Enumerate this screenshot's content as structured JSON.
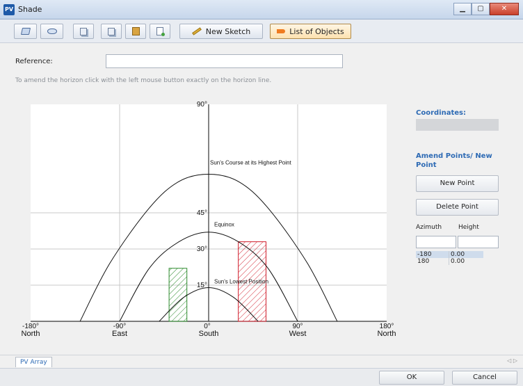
{
  "window": {
    "title": "Shade",
    "app_icon": "PV",
    "buttons": {
      "minimize": "▁",
      "maximize": "▢",
      "close": "✕"
    }
  },
  "toolbar": {
    "icons": [
      "folder-open-icon",
      "view-icon",
      "copy-icon",
      "copy-icon",
      "paste-icon",
      "new-document-icon",
      "pencil-icon",
      "list-icon"
    ],
    "new_sketch": "New Sketch",
    "list_of_objects": "List of Objects"
  },
  "reference": {
    "label": "Reference:",
    "value": ""
  },
  "hint": "To amend the horizon click with the left mouse button exactly on the horizon line.",
  "side_panel": {
    "coordinates_title": "Coordinates:",
    "coordinates_value": "",
    "amend_title": "Amend Points/ New Point",
    "new_point": "New Point",
    "delete_point": "Delete Point",
    "azimuth_label": "Azimuth",
    "height_label": "Height",
    "azimuth_input": "",
    "height_input": "",
    "points": [
      {
        "azimuth": "-180",
        "height": "0.00"
      },
      {
        "azimuth": "180",
        "height": "0.00"
      }
    ]
  },
  "tabs": [
    "PV Array"
  ],
  "tab_arrows": "◁ ▷",
  "dialog": {
    "ok": "OK",
    "cancel": "Cancel"
  },
  "chart_data": {
    "type": "line",
    "x_range": [
      -180,
      180
    ],
    "y_range": [
      0,
      90
    ],
    "x_ticks": [
      {
        "value": -180,
        "label": "-180°",
        "dir": "North"
      },
      {
        "value": -90,
        "label": "-90°",
        "dir": "East"
      },
      {
        "value": 0,
        "label": "0°",
        "dir": "South"
      },
      {
        "value": 90,
        "label": "90°",
        "dir": "West"
      },
      {
        "value": 180,
        "label": "180°",
        "dir": "North"
      }
    ],
    "y_ticks": [
      {
        "value": 15,
        "label": "15°"
      },
      {
        "value": 30,
        "label": "30°"
      },
      {
        "value": 45,
        "label": "45°"
      },
      {
        "value": 90,
        "label": "90°"
      }
    ],
    "curves": [
      {
        "name": "Sun's Course at its Highest Point",
        "x": [
          -130,
          -100,
          -60,
          -30,
          0,
          30,
          60,
          100,
          130
        ],
        "y": [
          0,
          24,
          47,
          58,
          61,
          58,
          47,
          24,
          0
        ]
      },
      {
        "name": "Equinox",
        "x": [
          -90,
          -60,
          -30,
          0,
          30,
          60,
          90
        ],
        "y": [
          0,
          22,
          33,
          37,
          33,
          22,
          0
        ]
      },
      {
        "name": "Sun's Lowest Position",
        "x": [
          -50,
          -25,
          0,
          25,
          50
        ],
        "y": [
          0,
          10,
          14,
          10,
          0
        ]
      }
    ],
    "objects": [
      {
        "name": "",
        "color": "#2e8b2e",
        "x0": -40,
        "x1": -22,
        "y": 22
      },
      {
        "name": "",
        "color": "#d01c2a",
        "x0": 30,
        "x1": 58,
        "y": 33
      }
    ]
  }
}
